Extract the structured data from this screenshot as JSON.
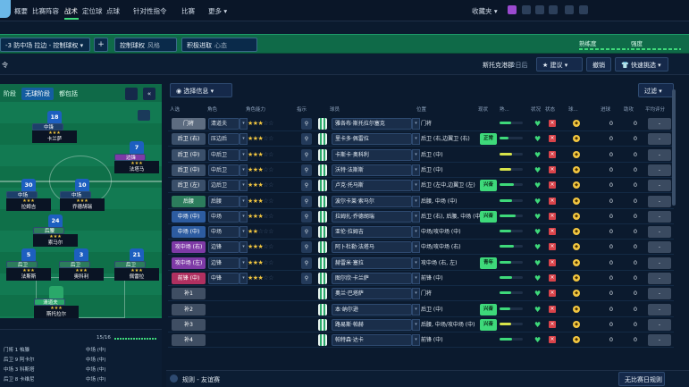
{
  "nav": {
    "items": [
      "概要",
      "比赛阵容",
      "战术",
      "定位球",
      "点球",
      "针对性指令",
      "比赛",
      "更多"
    ],
    "inbox": "收藏夹",
    "more_arrow": "▾"
  },
  "tactic": {
    "name": "-3 防中场 拉边 - 控制球权",
    "add": "+",
    "style_value": "控制球权",
    "style_key": "风格",
    "mentality_value": "积极进取",
    "mentality_key": "心态",
    "familiarity": "熟练度",
    "intensity": "强度"
  },
  "toolbar": {
    "left_label": "令",
    "club": "斯托克港郡",
    "days": "2日后",
    "suggest": "建议",
    "undo": "撤销",
    "quick_pick": "快速挑选"
  },
  "pitch": {
    "phases": [
      "阶段",
      "无球阶段",
      "都包括"
    ],
    "players": [
      {
        "num": "18",
        "role": "中锋",
        "name": "卡兰萨",
        "stars": "★★★"
      },
      {
        "num": "7",
        "role": "边锋",
        "name": "法塔马",
        "stars": "★★★"
      },
      {
        "num": "30",
        "role": "中场",
        "name": "拉姆吉",
        "stars": "★★★"
      },
      {
        "num": "10",
        "role": "中场",
        "name": "乔德胡瑞",
        "stars": "★★★"
      },
      {
        "num": "24",
        "role": "后腰",
        "name": "索马尔",
        "stars": "★★★"
      },
      {
        "num": "5",
        "role": "后卫",
        "name": "法斯斯",
        "stars": "★★★"
      },
      {
        "num": "3",
        "role": "后卫",
        "name": "奥科利",
        "stars": "★★★"
      },
      {
        "num": "21",
        "role": "后卫",
        "name": "佩雷拉",
        "stars": "★★★"
      },
      {
        "num": "",
        "role": "清道夫",
        "name": "斯托拉尔",
        "stars": "★★★"
      }
    ]
  },
  "bench": {
    "count": "15/16",
    "rows": [
      [
        "门将",
        "1",
        "帕滕",
        "中场 (中)"
      ],
      [
        "后卫",
        "9",
        "阿卡尔",
        "中场 (中)"
      ],
      [
        "中场",
        "3",
        "科斯塔",
        "中场 (中)"
      ],
      [
        "后卫",
        "8",
        "卡维尼",
        "中场 (中)"
      ]
    ]
  },
  "select_info": "选择信息",
  "filter": "过滤",
  "headers": [
    "人选",
    "角色",
    "角色能力",
    "指示",
    "",
    "球员",
    "位置",
    "现状",
    "熟...",
    "状况",
    "状态",
    "球...",
    "进球",
    "助攻",
    "平均评分"
  ],
  "rows": [
    {
      "pos": "门将",
      "cls": "b-gk",
      "role": "清道夫",
      "ra": 3,
      "name": "雅各布·斯托拉尔塞克",
      "ppos": "门将",
      "tag": "",
      "cond": 0.5,
      "cc": "",
      "g": "0",
      "a": "0"
    },
    {
      "pos": "后卫 (右)",
      "cls": "b-d",
      "role": "压边后",
      "ra": 3,
      "name": "里卡多·佩雷拉",
      "ppos": "后卫 (右,边翼卫 (右)",
      "tag": "正常",
      "cond": 0.4,
      "cc": "",
      "g": "0",
      "a": "0"
    },
    {
      "pos": "后卫 (中)",
      "cls": "b-d",
      "role": "中后卫",
      "ra": 3,
      "name": "卡斯卡·奥科利",
      "ppos": "后卫 (中)",
      "tag": "",
      "cond": 0.55,
      "cc": "y",
      "g": "0",
      "a": "0"
    },
    {
      "pos": "后卫 (中)",
      "cls": "b-d",
      "role": "中后卫",
      "ra": 3,
      "name": "沃特·法斯斯",
      "ppos": "后卫 (中)",
      "tag": "",
      "cond": 0.5,
      "cc": "y",
      "g": "0",
      "a": "0"
    },
    {
      "pos": "后卫 (左)",
      "cls": "b-d",
      "role": "边后卫",
      "ra": 3,
      "name": "卢克·托马斯",
      "ppos": "后卫 (左中,边翼卫 (左)",
      "tag": "兴奋",
      "cond": 0.6,
      "cc": "",
      "g": "0",
      "a": "0"
    },
    {
      "pos": "后腰",
      "cls": "b-dm",
      "role": "后腰",
      "ra": 3,
      "name": "波尔卡莱·索马尔",
      "ppos": "后腰, 中场 (中)",
      "tag": "",
      "cond": 0.55,
      "cc": "",
      "g": "0",
      "a": "0"
    },
    {
      "pos": "中场 (中)",
      "cls": "b-m",
      "role": "中场",
      "ra": 3,
      "name": "拉姆扎·乔德胡瑞",
      "ppos": "后卫 (右), 后腰, 中场 (中)",
      "tag": "兴奋",
      "cond": 0.7,
      "cc": "",
      "g": "0",
      "a": "0"
    },
    {
      "pos": "中场 (中)",
      "cls": "b-m",
      "role": "中场",
      "ra": 2,
      "name": "亚伦·拉姆吉",
      "ppos": "中场/攻中场 (中)",
      "tag": "",
      "cond": 0.5,
      "cc": "",
      "g": "0",
      "a": "0"
    },
    {
      "pos": "攻中场 (右)",
      "cls": "b-am",
      "role": "边锋",
      "ra": 3,
      "name": "阿卜杜勒·法塔马",
      "ppos": "中场/攻中场 (右)",
      "tag": "",
      "cond": 0.6,
      "cc": "",
      "g": "0",
      "a": "0"
    },
    {
      "pos": "攻中场 (左)",
      "cls": "b-am",
      "role": "边锋",
      "ra": 3,
      "name": "赫雷米·塞拉",
      "ppos": "攻中场 (右, 左)",
      "tag": "青年",
      "cond": 0.5,
      "cc": "",
      "g": "0",
      "a": "0"
    },
    {
      "pos": "前锋 (中)",
      "cls": "b-f",
      "role": "中锋",
      "ra": 3,
      "name": "图尔欣·卡兰萨",
      "ppos": "前锋 (中)",
      "tag": "",
      "cond": 0.55,
      "cc": "",
      "g": "0",
      "a": "0"
    },
    {
      "pos": "补1",
      "cls": "b-sub",
      "role": "",
      "ra": 0,
      "name": "奥兰·巴塔萨",
      "ppos": "门将",
      "tag": "",
      "cond": 0.5,
      "cc": "",
      "g": "0",
      "a": "0"
    },
    {
      "pos": "补2",
      "cls": "b-sub",
      "role": "",
      "ra": 0,
      "name": "本·纳尔逊",
      "ppos": "后卫 (中)",
      "tag": "兴奋",
      "cond": 0.45,
      "cc": "",
      "g": "0",
      "a": "0"
    },
    {
      "pos": "补3",
      "cls": "b-sub",
      "role": "",
      "ra": 0,
      "name": "路易斯·帕赫",
      "ppos": "后腰, 中场/攻中场 (中)",
      "tag": "兴奋",
      "cond": 0.5,
      "cc": "y",
      "g": "0",
      "a": "0"
    },
    {
      "pos": "补4",
      "cls": "b-sub",
      "role": "",
      "ra": 0,
      "name": "帕特森·达卡",
      "ppos": "前锋 (中)",
      "tag": "",
      "cond": 0.55,
      "cc": "",
      "g": "0",
      "a": "0"
    }
  ],
  "footer": {
    "rules": "规则 - 友谊赛",
    "no_rules": "无比赛日规则"
  }
}
